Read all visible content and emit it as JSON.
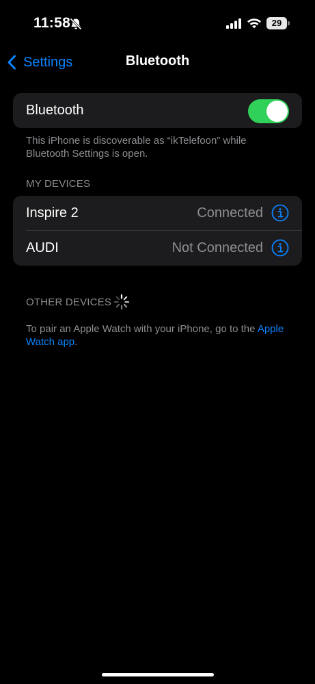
{
  "status_bar": {
    "time": "11:58",
    "battery": "29",
    "icons": [
      "bell-slash-icon",
      "cellular-signal-icon",
      "wifi-icon",
      "battery-icon"
    ]
  },
  "nav": {
    "back_label": "Settings",
    "title": "Bluetooth"
  },
  "bluetooth": {
    "label": "Bluetooth",
    "enabled": true,
    "footer": "This iPhone is discoverable as “ikTelefoon” while Bluetooth Settings is open."
  },
  "my_devices": {
    "header": "MY DEVICES",
    "devices": [
      {
        "name": "Inspire 2",
        "status": "Connected"
      },
      {
        "name": "AUDI",
        "status": "Not Connected"
      }
    ]
  },
  "other_devices": {
    "header": "OTHER DEVICES",
    "footer_text": "To pair an Apple Watch with your iPhone, go to the ",
    "footer_link": "Apple Watch app",
    "footer_end": "."
  },
  "colors": {
    "accent": "#0a84ff",
    "toggle_on": "#30d158",
    "cell_background": "#1c1c1e",
    "secondary_text": "#8e8e93"
  }
}
